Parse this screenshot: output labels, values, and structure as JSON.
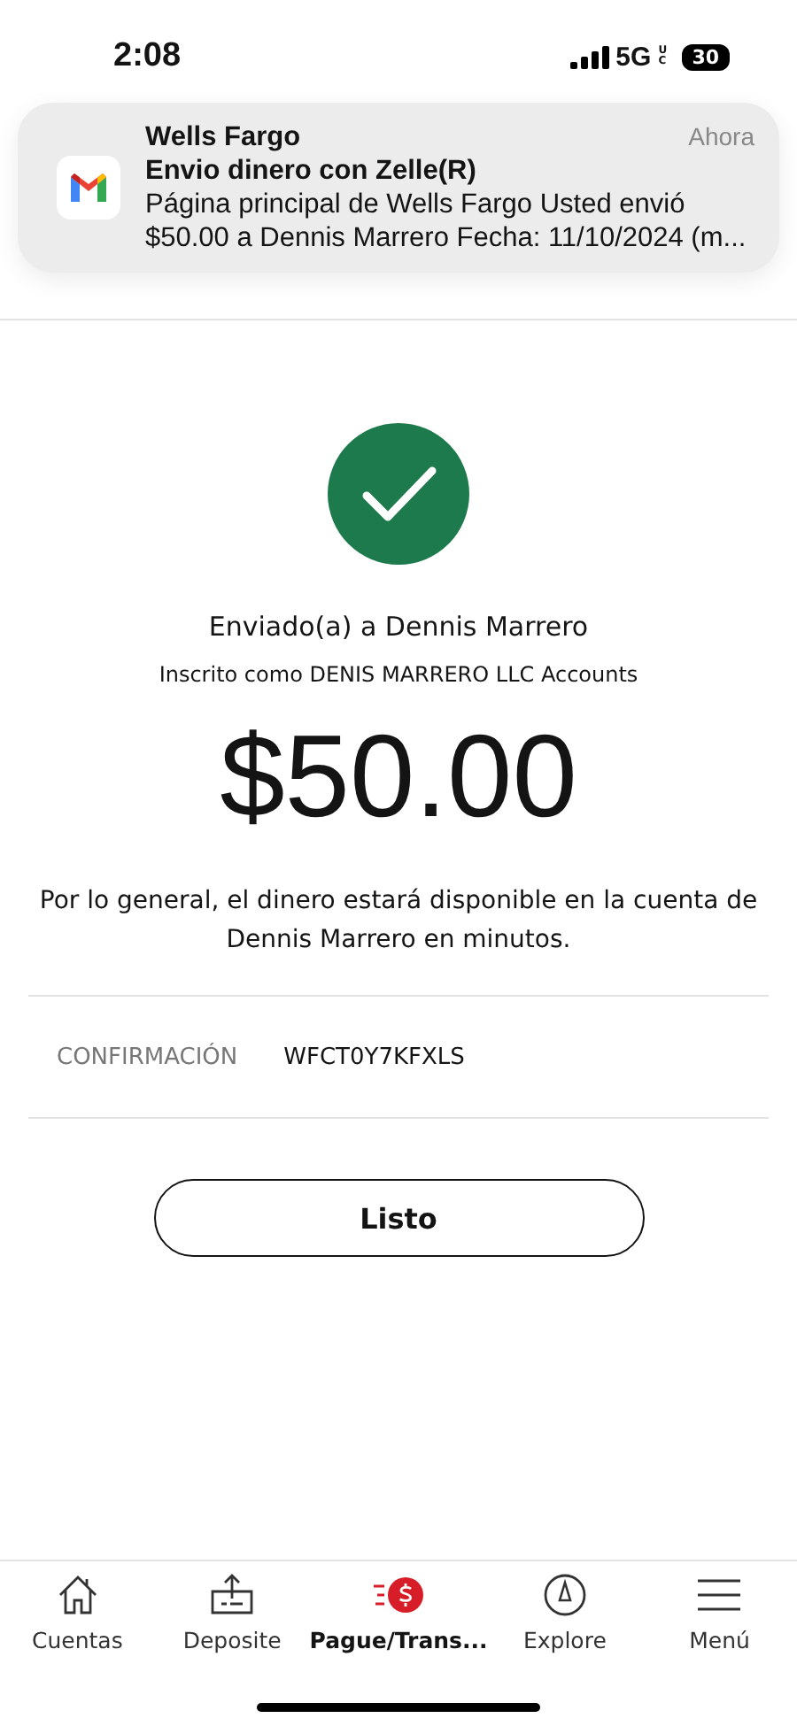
{
  "status_bar": {
    "time": "2:08",
    "network": "5G",
    "network_mark": "UC",
    "battery": "30"
  },
  "notification": {
    "app": "Wells Fargo",
    "time": "Ahora",
    "title": "Envio dinero con Zelle(R)",
    "body": "Página principal de Wells Fargo Usted envió $50.00 a Dennis Marrero Fecha: 11/10/2024 (m..."
  },
  "confirmation": {
    "sent_to": "Enviado(a) a Dennis Marrero",
    "enrolled_as": "Inscrito como DENIS MARRERO LLC Accounts",
    "amount": "$50.00",
    "message": "Por lo general, el dinero estará disponible en la cuenta de Dennis Marrero en minutos.",
    "label": "CONFIRMACIÓN",
    "code": "WFCT0Y7KFXLS"
  },
  "done_button": "Listo",
  "tab_bar": [
    {
      "kind": "home",
      "label": "Cuentas",
      "selected": false
    },
    {
      "kind": "deposit",
      "label": "Deposite",
      "selected": false
    },
    {
      "kind": "pay",
      "label": "Pague/Trans...",
      "selected": true
    },
    {
      "kind": "explore",
      "label": "Explore",
      "selected": false
    },
    {
      "kind": "menu",
      "label": "Menú",
      "selected": false
    }
  ]
}
